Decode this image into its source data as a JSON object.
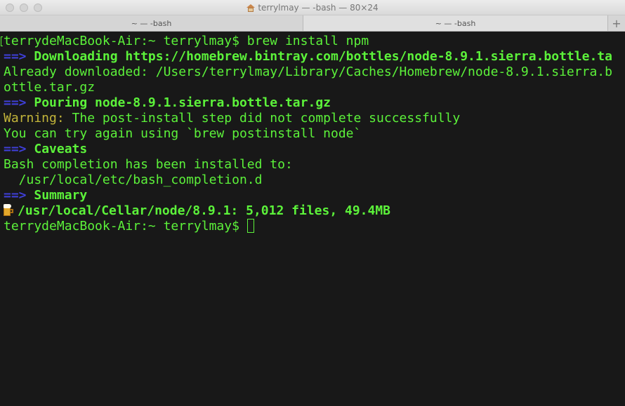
{
  "window": {
    "title": "terrylmay — -bash — 80×24"
  },
  "tabs": [
    {
      "label": "~ — -bash"
    },
    {
      "label": "~ — -bash"
    }
  ],
  "new_tab_symbol": "+",
  "terminal": {
    "line1": {
      "prompt": "terrydeMacBook-Air:~ terrylmay$ ",
      "command": "brew install npm"
    },
    "line2": {
      "arrow": "==>",
      "text": " Downloading https://homebrew.bintray.com/bottles/node-8.9.1.sierra.bottle.ta"
    },
    "line3": {
      "text": "Already downloaded: /Users/terrylmay/Library/Caches/Homebrew/node-8.9.1.sierra.b"
    },
    "line4": {
      "text": "ottle.tar.gz"
    },
    "line5": {
      "arrow": "==>",
      "text": " Pouring node-8.9.1.sierra.bottle.tar.gz"
    },
    "line6": {
      "warning": "Warning:",
      "text": " The post-install step did not complete successfully"
    },
    "line7": {
      "text": "You can try again using `brew postinstall node`"
    },
    "line8": {
      "arrow": "==>",
      "text": " Caveats"
    },
    "line9": {
      "text": "Bash completion has been installed to:"
    },
    "line10": {
      "text": "  /usr/local/etc/bash_completion.d"
    },
    "line11": {
      "arrow": "==>",
      "text": " Summary"
    },
    "line12": {
      "icon": "beer-icon",
      "text": "/usr/local/Cellar/node/8.9.1: 5,012 files, 49.4MB"
    },
    "line13": {
      "prompt": "terrydeMacBook-Air:~ terrylmay$ "
    }
  },
  "colors": {
    "output": "#5cf23a",
    "arrow": "#3f3fd9",
    "warning": "#c3b53a",
    "background": "#181818"
  }
}
